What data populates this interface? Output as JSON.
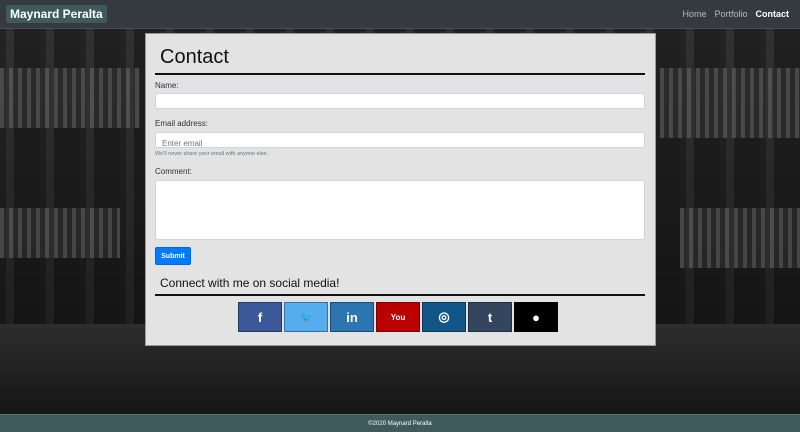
{
  "navbar": {
    "brand": "Maynard Peralta",
    "links": [
      {
        "label": "Home",
        "active": false
      },
      {
        "label": "Portfolio",
        "active": false
      },
      {
        "label": "Contact",
        "active": true
      }
    ]
  },
  "contact": {
    "title": "Contact",
    "name_label": "Name:",
    "name_value": "",
    "email_label": "Email address:",
    "email_placeholder": "Enter email",
    "email_help": "We'll never share your email with anyone else.",
    "comment_label": "Comment:",
    "comment_value": "",
    "submit_label": "Submit"
  },
  "social": {
    "title": "Connect with me on social media!",
    "buttons": [
      {
        "icon": "facebook-icon",
        "glyph": "f",
        "color": "#3b5998"
      },
      {
        "icon": "twitter-icon",
        "glyph": "🐦",
        "color": "#55acee"
      },
      {
        "icon": "linkedin-icon",
        "glyph": "in",
        "color": "#2c75b0"
      },
      {
        "icon": "youtube-icon",
        "glyph": "You",
        "color": "#bb0000"
      },
      {
        "icon": "instagram-icon",
        "glyph": "◎",
        "color": "#125688"
      },
      {
        "icon": "tumblr-icon",
        "glyph": "t",
        "color": "#34465d"
      },
      {
        "icon": "github-icon",
        "glyph": "●",
        "color": "#000000"
      }
    ]
  },
  "footer": {
    "text": "©2020 Maynard Peralta"
  }
}
